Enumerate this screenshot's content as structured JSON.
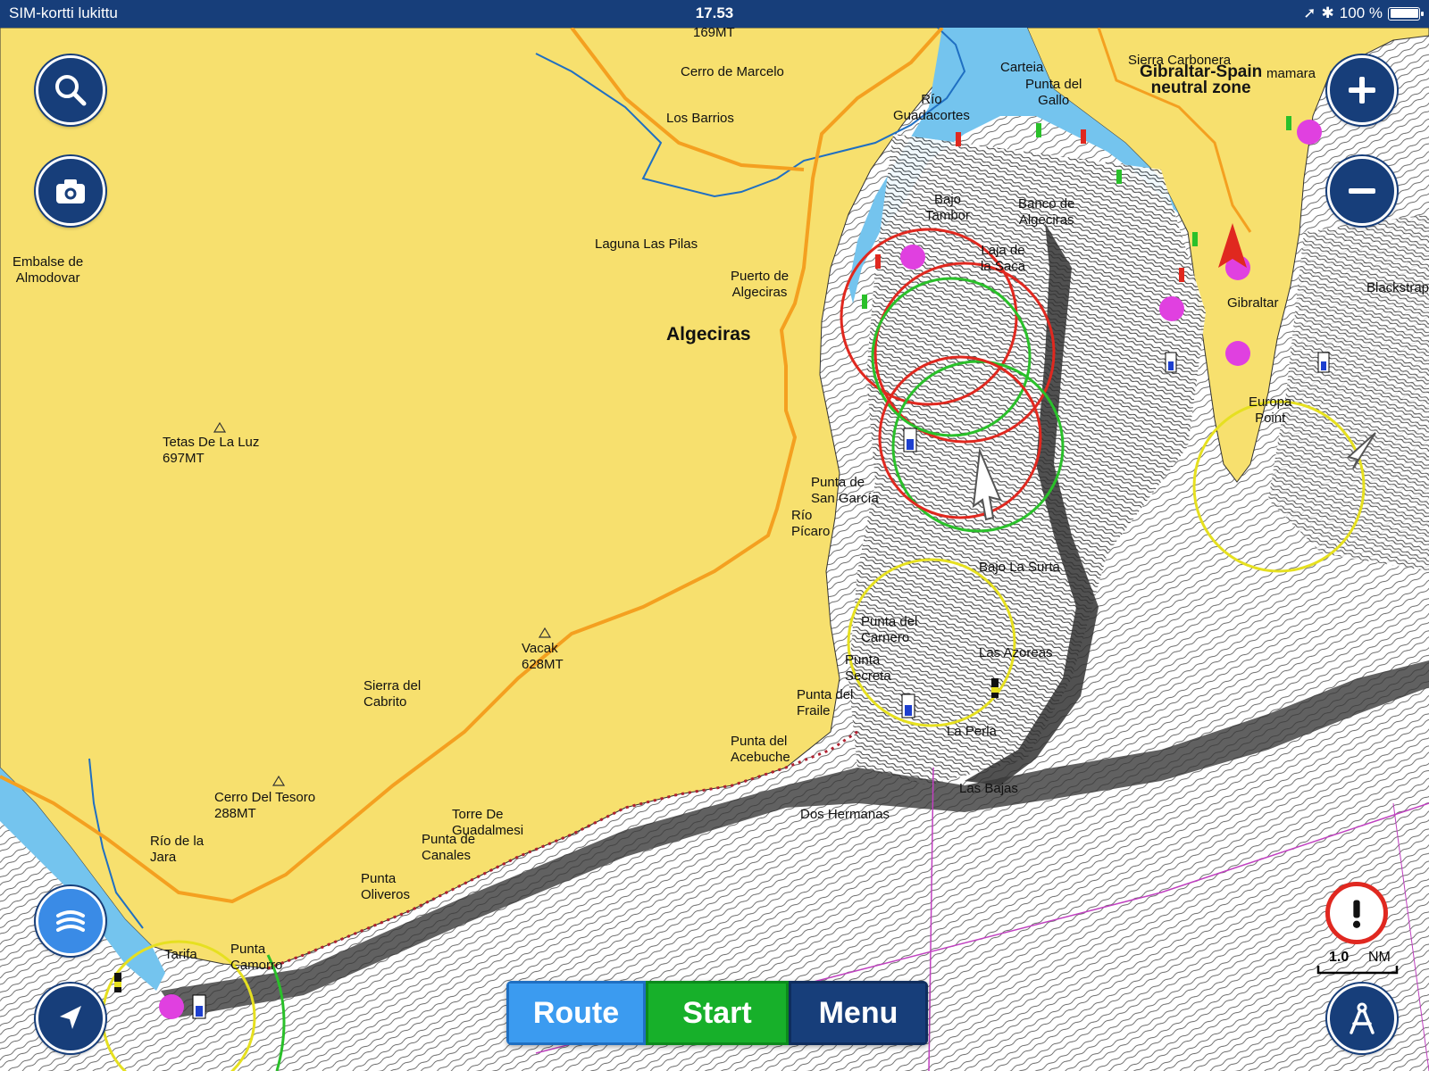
{
  "status_bar": {
    "carrier": "SIM-kortti lukittu",
    "time": "17.53",
    "battery": "100 %",
    "battery_level": 1.0
  },
  "map": {
    "colors": {
      "land": "#f7e06e",
      "water_shallow": "#74c4ee",
      "water_white": "#ffffff",
      "road": "#f4a020",
      "river": "#1f6fc2"
    },
    "labels": {
      "height_169": "169MT",
      "cerro_marcelo": "Cerro de Marcelo",
      "los_barrios": "Los Barrios",
      "carteia": "Carteia",
      "punta_gallo": "Punta del\nGallo",
      "rio_guadacortes": "Río\nGuadacortes",
      "sierra_carbonera": "Sierra Carbonera",
      "gibraltar_zone": "Gibraltar-Spain\nneutral zone",
      "mamara": "mamara",
      "embalse": "Embalse de\nAlmodovar",
      "laguna": "Laguna Las Pilas",
      "puerto_algeciras": "Puerto de\nAlgeciras",
      "algeciras": "Algeciras",
      "bajo_tambor": "Bajo\nTambor",
      "banco_algeciras": "Banco de\nAlgeciras",
      "laja_saca": "Laja de\nla Saca",
      "gibraltar": "Gibraltar",
      "blackstrap": "Blackstrap",
      "europa_point": "Europa\nPoint",
      "tetas": "Tetas De La Luz\n697MT",
      "punta_san_garcia": "Punta de\nSan García",
      "rio_picaro": "Río\nPícaro",
      "bajo_la_surta": "Bajo La Surta",
      "punta_carnero": "Punta del\nCarnero",
      "las_azoreas": "Las Azoreas",
      "punta_secreta": "Punta\nSecreta",
      "vacak": "Vacak\n628MT",
      "sierra_cabrito": "Sierra del\nCabrito",
      "punta_fraile": "Punta del\nFraile",
      "la_perla": "La Perla",
      "punta_acebuche": "Punta del\nAcebuche",
      "las_bajas": "Las Bajas",
      "cerro_tesoro": "Cerro Del Tesoro\n288MT",
      "dos_hermanas": "Dos Hermanas",
      "torre_guadalmesi": "Torre De\nGuadalmesi",
      "punta_canales": "Punta de\nCanales",
      "rio_jara": "Río de la\nJara",
      "punta_oliveros": "Punta\nOliveros",
      "tarifa": "Tarifa",
      "punta_camorro": "Punta\nCamorro"
    }
  },
  "controls": {
    "search": "search-icon",
    "camera": "camera-icon",
    "zoom_in": "plus-icon",
    "zoom_out": "minus-icon",
    "sonar": "sonar-icon",
    "locate": "navigation-arrow-icon",
    "warning": "exclamation-icon",
    "anchor_alarm": "compass-icon"
  },
  "scale": {
    "value": "1.0",
    "unit": "NM"
  },
  "bottom_bar": {
    "route": "Route",
    "start": "Start",
    "menu": "Menu"
  }
}
